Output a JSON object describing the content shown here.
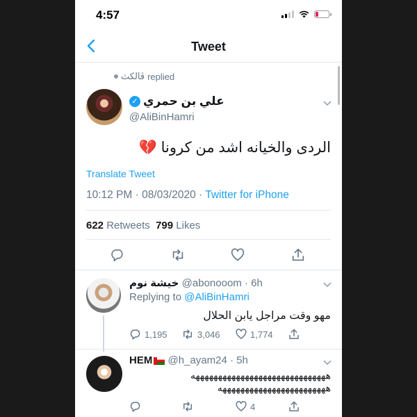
{
  "status_bar": {
    "time": "4:57"
  },
  "nav": {
    "title": "Tweet"
  },
  "tweet": {
    "replied_by": "ڤالكث",
    "replied_label": "replied",
    "author_name": "علي بن حمري",
    "author_handle": "@AliBinHamri",
    "text": "الردى  والخيانه اشد من كرونا 💔",
    "translate_label": "Translate Tweet",
    "time": "10:12 PM",
    "date": "08/03/2020",
    "source": "Twitter for iPhone",
    "retweets_count": "622",
    "retweets_label": "Retweets",
    "likes_count": "799",
    "likes_label": "Likes"
  },
  "replies": [
    {
      "name": "خيشة نوم",
      "handle": "@abonooom",
      "age": "6h",
      "replying_label": "Replying to",
      "replying_to": "@AliBinHamri",
      "text": "مهو وقت مراجل يابن الحلال",
      "reply_count": "1,195",
      "retweet_count": "3,046",
      "like_count": "1,774"
    },
    {
      "name": "HEM",
      "handle": "@h_ayam24",
      "age": "5h",
      "text_line1": "ههههههههههههههههههههههههههههههه",
      "text_line2": "ههههههههههههههههههههههههه",
      "like_count": "4"
    }
  ],
  "colors": {
    "accent": "#1da1f2",
    "muted": "#657786",
    "battery_low": "#e0245e"
  }
}
